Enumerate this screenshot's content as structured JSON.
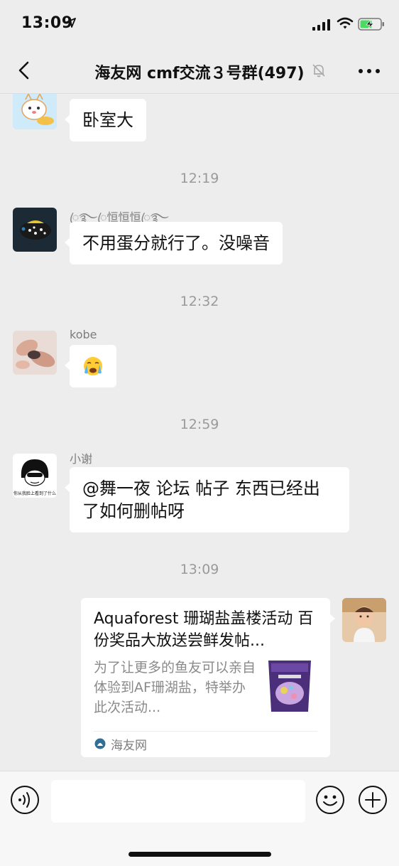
{
  "status_bar": {
    "time": "13:09",
    "icons": [
      "location-arrow-icon",
      "cellular-signal-icon",
      "wifi-icon",
      "battery-charging-icon"
    ]
  },
  "nav": {
    "title": "海友网 cmf交流３号群(497)",
    "back_icon": "chevron-left-icon",
    "mute_icon": "bell-slash-icon",
    "more_icon": "ellipsis-icon"
  },
  "messages": [
    {
      "sender": "",
      "text": "卧室大",
      "avatar": "cartoon-cat-avatar"
    },
    {
      "sender": "ꦿ࿐ꦿ恒恒恒ꦿ࿐",
      "text": "不用蛋分就行了。没噪音",
      "avatar": "pufferfish-avatar"
    },
    {
      "sender": "kobe",
      "text": "😭",
      "avatar": "hands-photo-avatar"
    },
    {
      "sender": "小谢",
      "text": "@舞一夜 论坛 帖子 东西已经出了如何删帖呀",
      "avatar": "meme-avatar"
    }
  ],
  "timestamps": [
    "12:19",
    "12:32",
    "12:59",
    "13:09"
  ],
  "meme_caption": "你从我脸上看到了什么",
  "link_card": {
    "title": "Aquaforest 珊瑚盐盖楼活动 百份奖品大放送尝鲜发帖...",
    "description": "为了让更多的鱼友可以亲自体验到AF珊湖盐，特举办此次活动...",
    "source": "海友网",
    "thumbnail": "salt-bag-thumbnail"
  },
  "input_bar": {
    "voice_icon": "voice-icon",
    "emoji_icon": "smiley-icon",
    "plus_icon": "plus-circle-icon",
    "placeholder": ""
  },
  "colors": {
    "background": "#ededed",
    "bubble": "#ffffff",
    "timestamp": "#9a9a9a",
    "sender": "#7d7d7d"
  }
}
